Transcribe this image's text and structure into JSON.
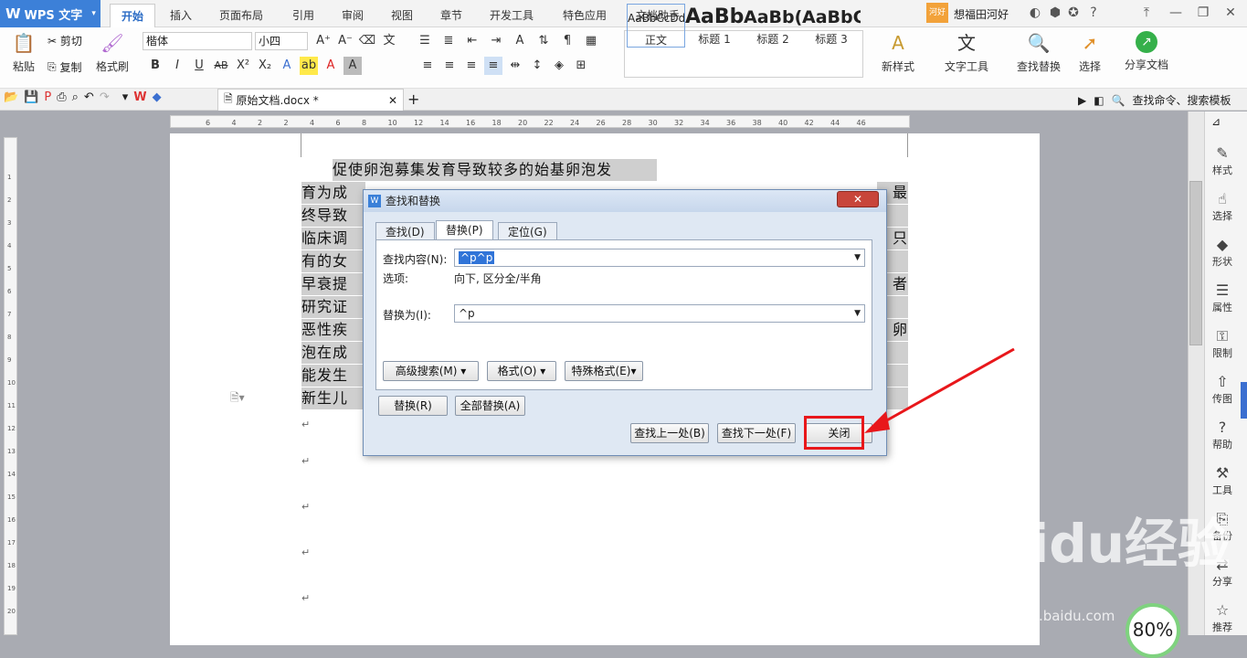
{
  "app": {
    "name": "WPS 文字"
  },
  "menu_tabs": [
    "开始",
    "插入",
    "页面布局",
    "引用",
    "审阅",
    "视图",
    "章节",
    "开发工具",
    "特色应用",
    "文档助手"
  ],
  "title_right": {
    "badge": "河好",
    "user": "想福田河好",
    "help": "?"
  },
  "ribbon": {
    "clipboard": {
      "paste": "粘贴",
      "cut": "剪切",
      "copy": "复制",
      "format_painter": "格式刷"
    },
    "font": {
      "family": "楷体",
      "size": "小四"
    },
    "styles": [
      {
        "preview": "AaBbCcDd",
        "name": "正文"
      },
      {
        "preview": "AaBb",
        "name": "标题 1"
      },
      {
        "preview": "AaBb(",
        "name": "标题 2"
      },
      {
        "preview": "AaBbC",
        "name": "标题 3"
      }
    ],
    "new_style": "新样式",
    "text_tools": "文字工具",
    "find_replace": "查找替换",
    "select": "选择",
    "share": "分享文档"
  },
  "quickbar": {
    "doc_tab": "原始文档.docx *",
    "search": "查找命令、搜索模板"
  },
  "document": {
    "lines": [
      "促使卵泡募集发育导致较多的始基卵泡发",
      "育为成",
      "终导致",
      "临床调",
      "有的女",
      "早衰提",
      "研究证",
      "恶性疾",
      "泡在成",
      "能发生",
      "新生儿"
    ],
    "right_fragments": [
      "最",
      "",
      "只",
      "",
      "者",
      "",
      "卵"
    ]
  },
  "ruler": {
    "ticks": [
      "6",
      "4",
      "2",
      "2",
      "4",
      "6",
      "8",
      "10",
      "12",
      "14",
      "16",
      "18",
      "20",
      "22",
      "24",
      "26",
      "28",
      "30",
      "32",
      "34",
      "36",
      "38",
      "40",
      "42",
      "44",
      "46"
    ]
  },
  "vruler": {
    "ticks": [
      "1",
      "2",
      "3",
      "4",
      "5",
      "6",
      "7",
      "8",
      "9",
      "10",
      "11",
      "12",
      "13",
      "14",
      "15",
      "16",
      "17",
      "18",
      "19",
      "20"
    ]
  },
  "sidepanel": [
    "样式",
    "选择",
    "形状",
    "属性",
    "限制",
    "传图",
    "帮助",
    "工具",
    "备份",
    "分享",
    "推荐"
  ],
  "dialog": {
    "title": "查找和替换",
    "tabs": [
      "查找(D)",
      "替换(P)",
      "定位(G)"
    ],
    "find_label": "查找内容(N):",
    "find_value": "^p^p",
    "options_label": "选项:",
    "options_value": "向下, 区分全/半角",
    "replace_label": "替换为(I):",
    "replace_value": "^p",
    "advanced": "高级搜索(M)",
    "format": "格式(O)",
    "special": "特殊格式(E)",
    "replace_btn": "替换(R)",
    "replace_all": "全部替换(A)",
    "find_prev": "查找上一处(B)",
    "find_next": "查找下一处(F)",
    "close": "关闭"
  },
  "zoom": "80%",
  "watermark": {
    "logo": "Baidu经验",
    "url": "jingyan.baidu.com"
  }
}
